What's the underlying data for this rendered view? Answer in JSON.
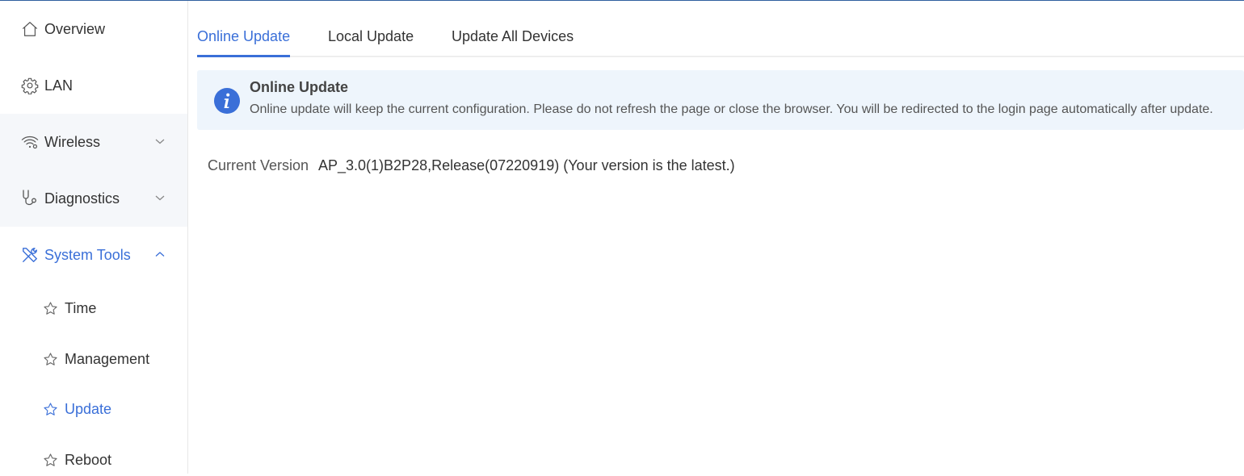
{
  "sidebar": {
    "items": [
      {
        "label": "Overview",
        "icon": "home-icon"
      },
      {
        "label": "LAN",
        "icon": "gear-icon"
      },
      {
        "label": "Wireless",
        "icon": "wifi-gear-icon",
        "expandable": true,
        "expanded": false
      },
      {
        "label": "Diagnostics",
        "icon": "stethoscope-icon",
        "expandable": true,
        "expanded": false
      },
      {
        "label": "System Tools",
        "icon": "tools-icon",
        "expandable": true,
        "expanded": true,
        "active": true
      }
    ],
    "sub_items": [
      {
        "label": "Time",
        "icon": "star-icon"
      },
      {
        "label": "Management",
        "icon": "star-icon"
      },
      {
        "label": "Update",
        "icon": "star-icon",
        "active": true
      },
      {
        "label": "Reboot",
        "icon": "star-icon"
      }
    ]
  },
  "tabs": [
    {
      "label": "Online Update",
      "active": true
    },
    {
      "label": "Local Update",
      "active": false
    },
    {
      "label": "Update All Devices",
      "active": false
    }
  ],
  "info": {
    "title": "Online Update",
    "text": "Online update will keep the current configuration. Please do not refresh the page or close the browser. You will be redirected to the login page automatically after update."
  },
  "version": {
    "label": "Current Version",
    "value": "AP_3.0(1)B2P28,Release(07220919) (Your version is the latest.)"
  },
  "colors": {
    "accent": "#3a6fd8",
    "info_bg": "#eef5fc",
    "info_icon": "#3a6fd8",
    "sidebar_shade": "#f5f7fa",
    "top_border": "#2f5f9e"
  }
}
